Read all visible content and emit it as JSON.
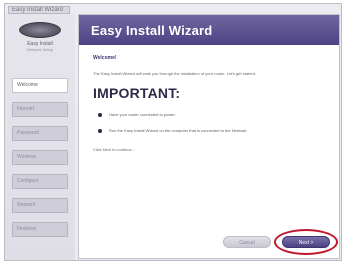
{
  "window": {
    "tab_label": "Easy Install Wizard"
  },
  "sidebar": {
    "logo_line1": "Easy Install",
    "logo_line2": "Network Setup",
    "items": [
      {
        "label": "Welcome"
      },
      {
        "label": "Internet"
      },
      {
        "label": "Password"
      },
      {
        "label": "Wireless"
      },
      {
        "label": "Configure"
      },
      {
        "label": "Network"
      },
      {
        "label": "Finished"
      }
    ]
  },
  "header": {
    "title": "Easy Install Wizard"
  },
  "content": {
    "welcome": "Welcome!",
    "intro": "The Easy Install Wizard will walk you through the installation of your router. Let's get started.",
    "important": "IMPORTANT:",
    "bullets": [
      {
        "text": "Have your router connected to power."
      },
      {
        "text": "Run the Easy Install Wizard on the computer that is connected to the Network."
      }
    ],
    "continue": "Click Next to continue..."
  },
  "buttons": {
    "cancel": "Cancel",
    "next": "Next >"
  },
  "colors": {
    "header_top": "#7066a0",
    "header_bottom": "#4d4384",
    "highlight": "#c0182c"
  }
}
